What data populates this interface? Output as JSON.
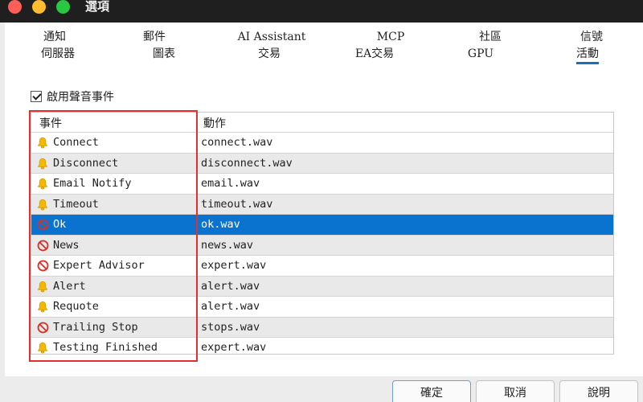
{
  "window": {
    "title": "選項"
  },
  "tabs": {
    "row1": [
      "通知",
      "郵件",
      "AI Assistant",
      "MCP",
      "社區",
      "信號"
    ],
    "row2": [
      "伺服器",
      "圖表",
      "交易",
      "EA交易",
      "GPU",
      "活動"
    ],
    "active": "活動"
  },
  "settings": {
    "enable_sound_label": "啟用聲音事件",
    "enable_sound_checked": true
  },
  "table": {
    "headers": {
      "event": "事件",
      "action": "動作"
    },
    "rows": [
      {
        "event": "Connect",
        "action": "connect.wav",
        "icon": "bell-icon"
      },
      {
        "event": "Disconnect",
        "action": "disconnect.wav",
        "icon": "bell-icon"
      },
      {
        "event": "Email Notify",
        "action": "email.wav",
        "icon": "bell-icon"
      },
      {
        "event": "Timeout",
        "action": "timeout.wav",
        "icon": "bell-icon"
      },
      {
        "event": "Ok",
        "action": "ok.wav",
        "icon": "disabled-icon",
        "selected": true
      },
      {
        "event": "News",
        "action": "news.wav",
        "icon": "disabled-icon"
      },
      {
        "event": "Expert Advisor",
        "action": "expert.wav",
        "icon": "disabled-icon"
      },
      {
        "event": "Alert",
        "action": "alert.wav",
        "icon": "bell-icon"
      },
      {
        "event": "Requote",
        "action": "alert.wav",
        "icon": "bell-icon"
      },
      {
        "event": "Trailing Stop",
        "action": "stops.wav",
        "icon": "disabled-icon"
      },
      {
        "event": "Testing Finished",
        "action": "expert.wav",
        "icon": "bell-icon"
      }
    ]
  },
  "buttons": {
    "ok": "確定",
    "cancel": "取消",
    "help": "說明"
  },
  "colors": {
    "accent": "#0a73d0",
    "highlight_box": "#e0312f",
    "bell": "#f5b800",
    "disabled": "#d93025"
  }
}
